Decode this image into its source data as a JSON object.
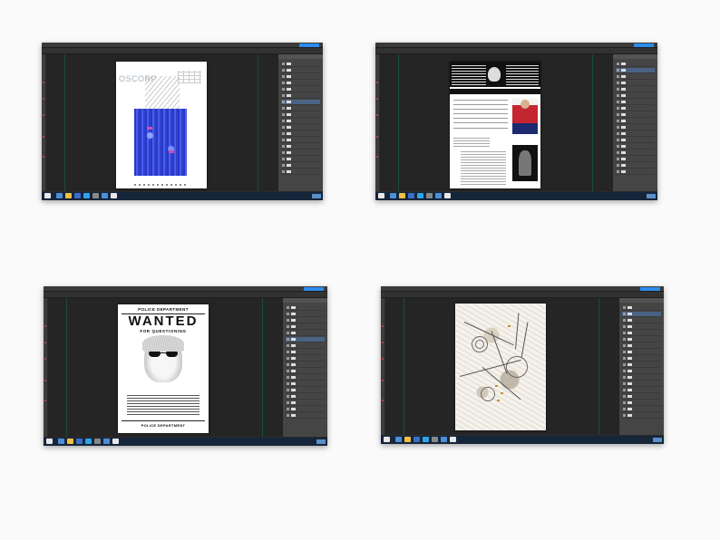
{
  "screenshots": [
    {
      "id": "shot-1",
      "document": {
        "kind": "oscorp-poster",
        "logo_text": "OSCORP"
      },
      "colors": {
        "accent": "#2d8ceb",
        "workspace": "#252525"
      }
    },
    {
      "id": "shot-2",
      "document": {
        "kind": "shield-dossier"
      },
      "colors": {
        "accent": "#2d8ceb",
        "workspace": "#252525"
      }
    },
    {
      "id": "shot-3",
      "document": {
        "kind": "wanted-poster",
        "top_label": "POLICE DEPARTMENT",
        "title": "WANTED",
        "subtitle": "FOR QUESTIONING",
        "footer_label": "POLICE DEPARTMENT"
      },
      "colors": {
        "accent": "#2d8ceb",
        "workspace": "#252525"
      }
    },
    {
      "id": "shot-4",
      "document": {
        "kind": "pencil-sketch"
      },
      "colors": {
        "accent": "#2d8ceb",
        "workspace": "#252525"
      }
    }
  ],
  "icons": {
    "panel_eye": "eye-icon",
    "layer_thumb": "layer-thumbnail-icon",
    "taskbar_apps": "taskbar-app-icon",
    "clock": "clock-icon"
  },
  "theme": {
    "page_background": "#fafafa",
    "ps_chrome": "#2b2b2b",
    "selected_layer": "#4a6384"
  }
}
